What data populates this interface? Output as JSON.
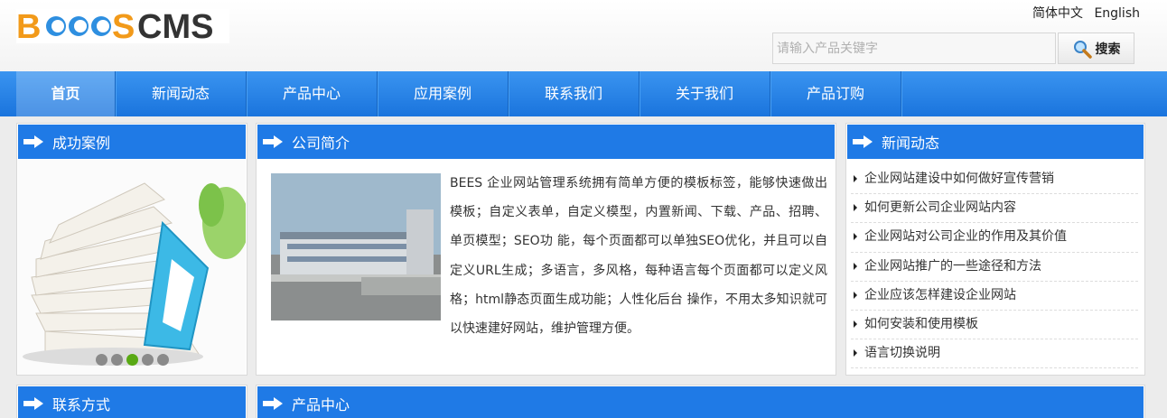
{
  "header": {
    "logo_text": "BEES CMS",
    "lang": [
      "简体中文",
      "English"
    ],
    "search_placeholder": "请输入产品关键字",
    "search_button": "搜索"
  },
  "nav": {
    "items": [
      "首页",
      "新闻动态",
      "产品中心",
      "应用案例",
      "联系我们",
      "关于我们",
      "产品订购"
    ],
    "active": "首页"
  },
  "cases": {
    "title": "成功案例",
    "slides": 5,
    "current_slide": 3
  },
  "intro": {
    "title": "公司简介",
    "text": "BEES 企业网站管理系统拥有简单方便的模板标签，能够快速做出模板；自定义表单，自定义模型，内置新闻、下载、产品、招聘、单页模型；SEO功 能，每个页面都可以单独SEO优化，并且可以自定义URL生成；多语言，多风格，每种语言每个页面都可以定义风格；html静态页面生成功能；人性化后台 操作，不用太多知识就可以快速建好网站，维护管理方便。"
  },
  "news": {
    "title": "新闻动态",
    "items": [
      "企业网站建设中如何做好宣传营销",
      "如何更新公司企业网站内容",
      "企业网站对公司企业的作用及其价值",
      "企业网站推广的一些途径和方法",
      "企业应该怎样建设企业网站",
      "如何安装和使用模板",
      "语言切换说明"
    ]
  },
  "contact": {
    "title": "联系方式"
  },
  "products": {
    "title": "产品中心"
  },
  "colors": {
    "accent": "#1f7ae6",
    "nav": "#2a84e8"
  }
}
